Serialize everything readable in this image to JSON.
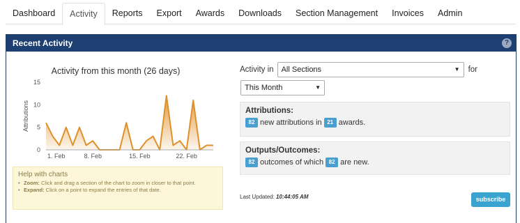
{
  "nav": {
    "tabs": [
      {
        "label": "Dashboard",
        "active": false
      },
      {
        "label": "Activity",
        "active": true
      },
      {
        "label": "Reports",
        "active": false
      },
      {
        "label": "Export",
        "active": false
      },
      {
        "label": "Awards",
        "active": false
      },
      {
        "label": "Downloads",
        "active": false
      },
      {
        "label": "Section Management",
        "active": false
      },
      {
        "label": "Invoices",
        "active": false
      },
      {
        "label": "Admin",
        "active": false
      }
    ]
  },
  "panel": {
    "title": "Recent Activity",
    "help_glyph": "?"
  },
  "chart_data": {
    "type": "area",
    "title": "Activity from this month (26 days)",
    "ylabel": "Attributions",
    "xlabel": "",
    "ylim": [
      0,
      15
    ],
    "yticks": [
      0,
      5,
      10,
      15
    ],
    "x": [
      "1. Feb",
      "2. Feb",
      "3. Feb",
      "4. Feb",
      "5. Feb",
      "6. Feb",
      "7. Feb",
      "8. Feb",
      "9. Feb",
      "10. Feb",
      "11. Feb",
      "12. Feb",
      "13. Feb",
      "14. Feb",
      "15. Feb",
      "16. Feb",
      "17. Feb",
      "18. Feb",
      "19. Feb",
      "20. Feb",
      "21. Feb",
      "22. Feb",
      "23. Feb",
      "24. Feb",
      "25. Feb",
      "26. Feb"
    ],
    "xtick_labels": [
      "1. Feb",
      "8. Feb",
      "15. Feb",
      "22. Feb"
    ],
    "values": [
      6,
      3,
      1,
      5,
      1,
      5,
      1,
      2,
      0,
      0,
      0,
      0,
      6,
      0,
      0,
      2,
      3,
      0,
      12,
      1,
      2,
      0,
      11,
      0,
      1,
      1
    ],
    "color": "#e0902a",
    "grid": false
  },
  "help": {
    "title": "Help with charts",
    "items": [
      {
        "term": "Zoom:",
        "text": " Click and drag a section of the chart to zoom in closer to that point."
      },
      {
        "term": "Expand:",
        "text": " Click on a point to expand the entries of that date."
      }
    ]
  },
  "filters": {
    "activity_in_label": "Activity in",
    "section_value": "All Sections",
    "for_label": "for",
    "period_value": "This Month",
    "arrow_glyph": "▼"
  },
  "attributions": {
    "title": "Attributions:",
    "count": "82",
    "text1": "new attributions in",
    "awards_count": "21",
    "text2": "awards."
  },
  "outputs": {
    "title": "Outputs/Outcomes:",
    "count": "82",
    "text1": "outcomes of which",
    "new_count": "82",
    "text2": "are new."
  },
  "footer": {
    "updated_label": "Last Updated:",
    "updated_time": "10:44:05 AM",
    "subscribe_label": "subscribe"
  }
}
